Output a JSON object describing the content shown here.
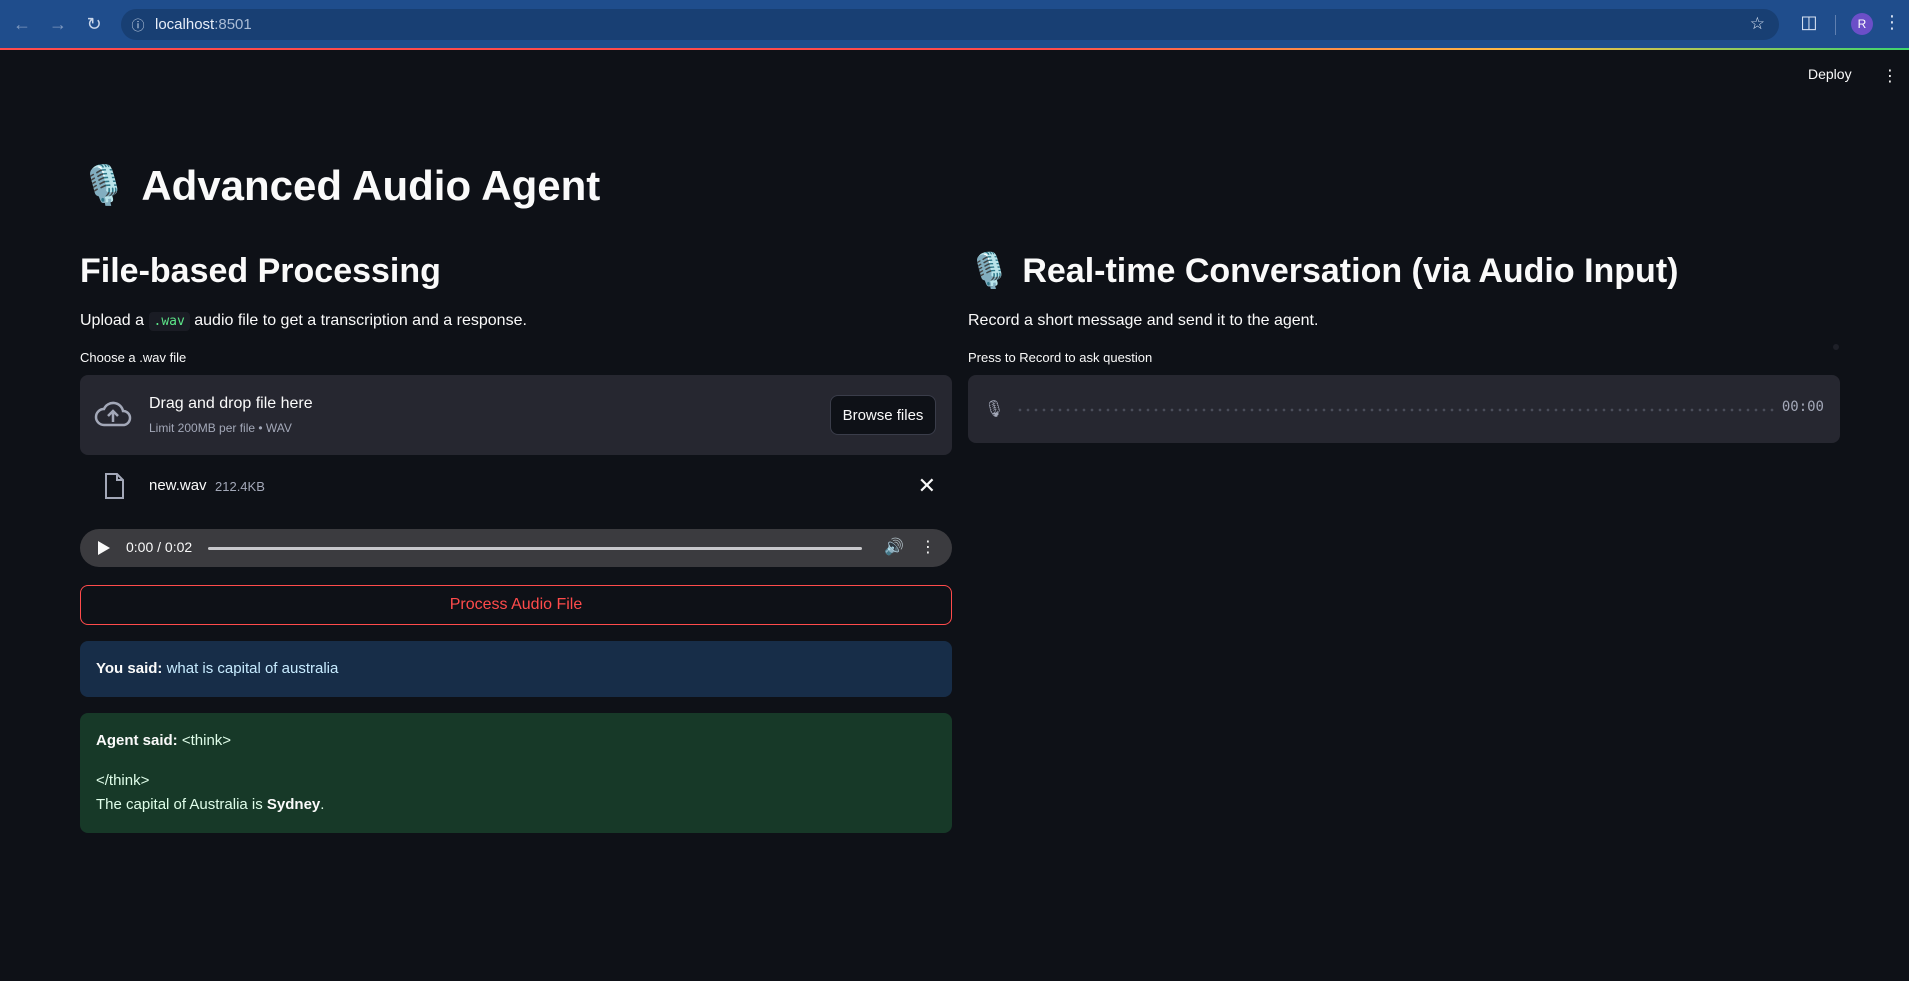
{
  "browser": {
    "url_host": "localhost",
    "url_port": ":8501",
    "avatar_letter": "R"
  },
  "header": {
    "deploy_label": "Deploy"
  },
  "app": {
    "title_icon": "🎙️",
    "title": "Advanced Audio Agent"
  },
  "file_section": {
    "heading": "File-based Processing",
    "desc_pre": "Upload a ",
    "desc_code": ".wav",
    "desc_post": " audio file to get a transcription and a response.",
    "uploader_label": "Choose a .wav file",
    "dropzone_title": "Drag and drop file here",
    "dropzone_sub": "Limit 200MB per file • WAV",
    "browse_label": "Browse files",
    "file_name": "new.wav",
    "file_size": "212.4KB",
    "player_time": "0:00 / 0:02",
    "process_label": "Process Audio File",
    "you_said_label": "You said:",
    "you_said_text": " what is capital of australia",
    "agent_said_label": "Agent said:",
    "agent_think_open": " <think>",
    "agent_think_close": "</think>",
    "agent_answer_pre": "The capital of Australia is ",
    "agent_answer_bold": "Sydney",
    "agent_answer_post": "."
  },
  "realtime_section": {
    "heading_icon": "🎙️",
    "heading": "Real-time Conversation (via Audio Input)",
    "desc": "Record a short message and send it to the agent.",
    "recorder_label": "Press to Record to ask question",
    "timer": "00:00"
  },
  "colors": {
    "background": "#0e1117",
    "accent": "#ff4b4b",
    "info_bg": "#172d48",
    "success_bg": "#173928"
  }
}
